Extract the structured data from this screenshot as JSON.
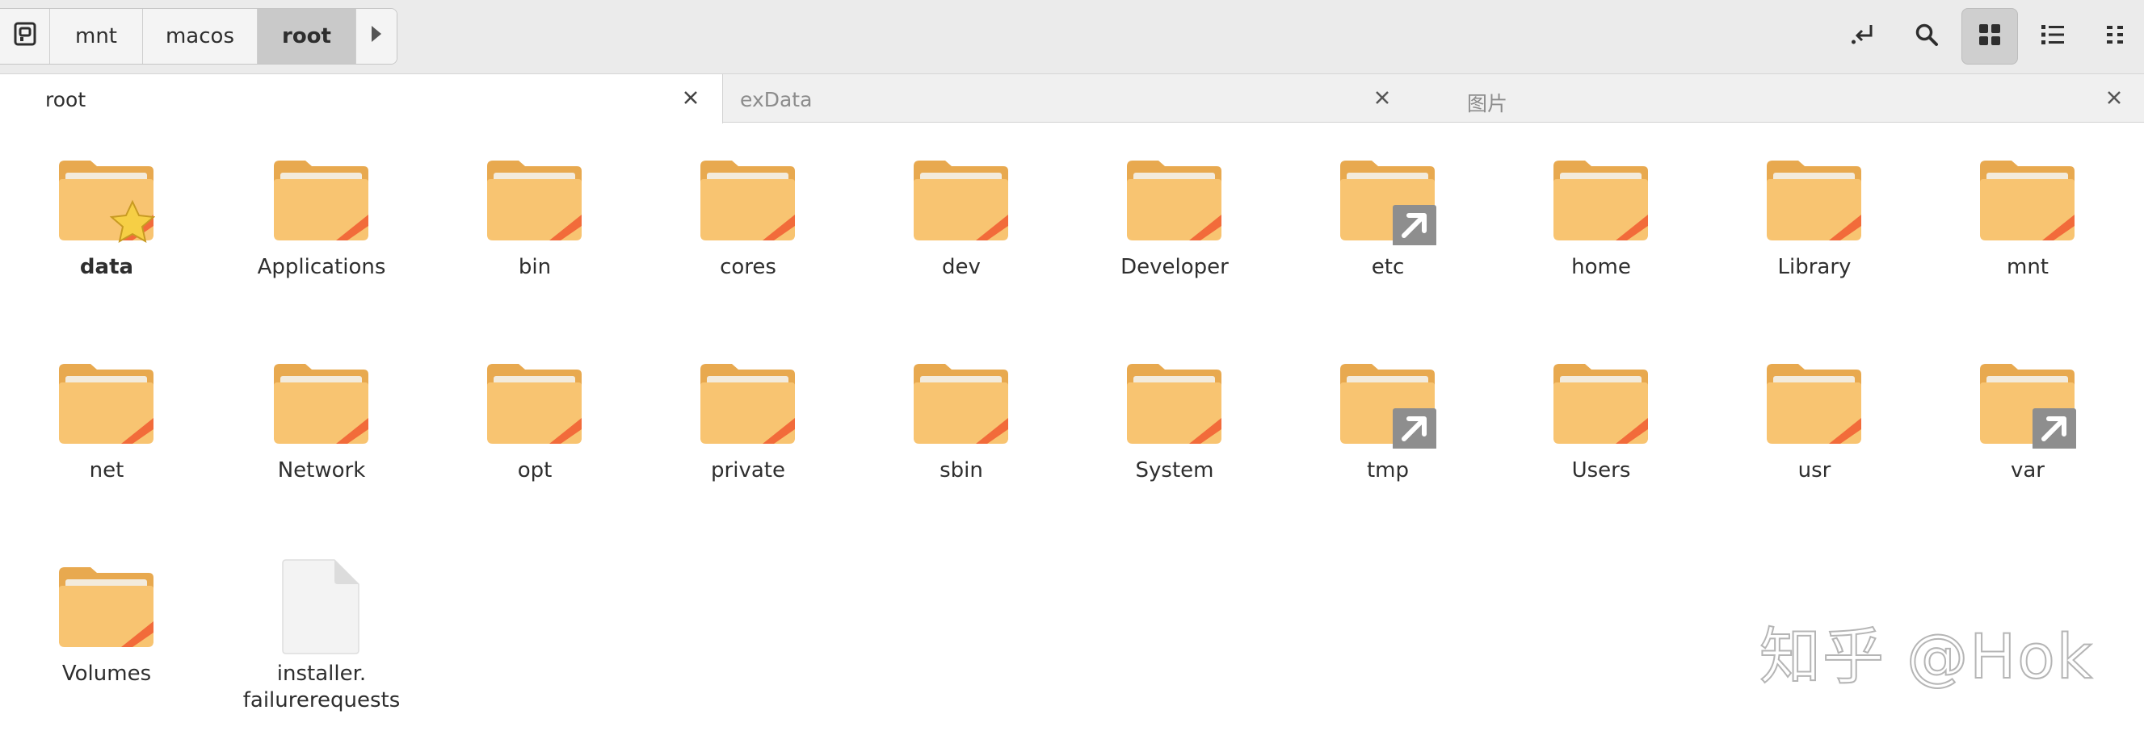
{
  "breadcrumb": {
    "segments": [
      "mnt",
      "macos",
      "root"
    ],
    "current": "root"
  },
  "toolbar": {
    "icons": [
      "enter-location-icon",
      "search-icon",
      "grid-view-icon",
      "list-view-icon",
      "menu-icon"
    ],
    "active": "grid-view-icon"
  },
  "tabs": [
    {
      "label": "root",
      "active": true
    },
    {
      "label": "exData",
      "active": false
    },
    {
      "label": "图片",
      "active": false
    }
  ],
  "items": [
    {
      "name": "data",
      "type": "folder",
      "emblem": "star",
      "bold": true
    },
    {
      "name": "Applications",
      "type": "folder"
    },
    {
      "name": "bin",
      "type": "folder"
    },
    {
      "name": "cores",
      "type": "folder"
    },
    {
      "name": "dev",
      "type": "folder"
    },
    {
      "name": "Developer",
      "type": "folder"
    },
    {
      "name": "etc",
      "type": "folder",
      "emblem": "link"
    },
    {
      "name": "home",
      "type": "folder"
    },
    {
      "name": "Library",
      "type": "folder"
    },
    {
      "name": "mnt",
      "type": "folder"
    },
    {
      "name": "net",
      "type": "folder"
    },
    {
      "name": "Network",
      "type": "folder"
    },
    {
      "name": "opt",
      "type": "folder"
    },
    {
      "name": "private",
      "type": "folder"
    },
    {
      "name": "sbin",
      "type": "folder"
    },
    {
      "name": "System",
      "type": "folder"
    },
    {
      "name": "tmp",
      "type": "folder",
      "emblem": "link"
    },
    {
      "name": "Users",
      "type": "folder"
    },
    {
      "name": "usr",
      "type": "folder"
    },
    {
      "name": "var",
      "type": "folder",
      "emblem": "link"
    },
    {
      "name": "Volumes",
      "type": "folder"
    },
    {
      "name": "installer.\nfailurerequests",
      "type": "file"
    }
  ],
  "watermark": "知乎 @Hok",
  "colors": {
    "folder_body": "#f8c471",
    "folder_back": "#e8a94f",
    "folder_paper": "#f3ebdc",
    "folder_stripe": "#f26b3a",
    "link_emblem": "#8e8e8e",
    "star": "#f6cf45"
  }
}
